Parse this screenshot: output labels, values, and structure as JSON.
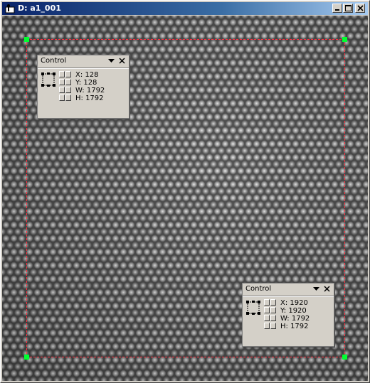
{
  "window": {
    "title": "D: a1_001",
    "icon": "app-person-icon"
  },
  "title_buttons": [
    "minimize-button",
    "maximize-button",
    "close-button"
  ],
  "controls": [
    {
      "header": "Control",
      "x": "X: 128",
      "y": "Y: 128",
      "w": "W: 1792",
      "h": "H: 1792"
    },
    {
      "header": "Control",
      "x": "X: 1920",
      "y": "Y: 1920",
      "w": "W: 1792",
      "h": "H: 1792"
    }
  ],
  "colors": {
    "roi": "#ff3040",
    "handle": "#00ff30",
    "titlebar": "#0a246a"
  }
}
